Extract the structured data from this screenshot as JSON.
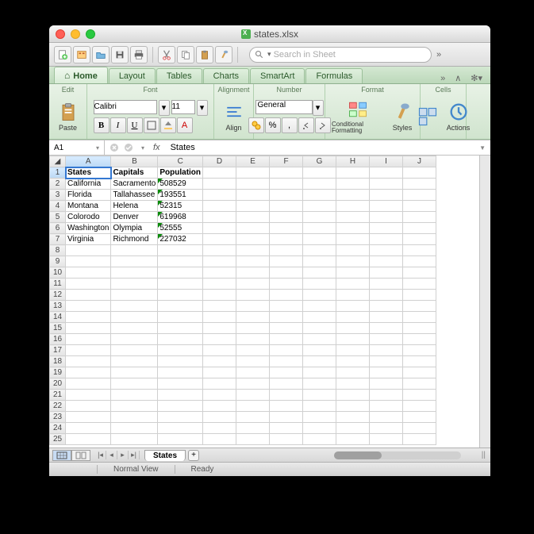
{
  "window": {
    "title": "states.xlsx"
  },
  "search": {
    "placeholder": "Search in Sheet"
  },
  "ribbontabs": [
    "Home",
    "Layout",
    "Tables",
    "Charts",
    "SmartArt",
    "Formulas"
  ],
  "ribbon": {
    "edit": {
      "label": "Edit",
      "paste": "Paste"
    },
    "font": {
      "label": "Font",
      "name": "Calibri",
      "size": "11"
    },
    "alignment": {
      "label": "Alignment",
      "align": "Align"
    },
    "number": {
      "label": "Number",
      "format": "General"
    },
    "format": {
      "label": "Format",
      "cond": "Conditional Formatting",
      "styles": "Styles"
    },
    "cells": {
      "label": "Cells",
      "actions": "Actions"
    }
  },
  "namebox": "A1",
  "formulaValue": "States",
  "columns": [
    "A",
    "B",
    "C",
    "D",
    "E",
    "F",
    "G",
    "H",
    "I",
    "J"
  ],
  "rows": [
    1,
    2,
    3,
    4,
    5,
    6,
    7,
    8,
    9,
    10,
    11,
    12,
    13,
    14,
    15,
    16,
    17,
    18,
    19,
    20,
    21,
    22,
    23,
    24,
    25
  ],
  "cells": {
    "1": {
      "A": "States",
      "B": "Capitals",
      "C": "Population"
    },
    "2": {
      "A": "California",
      "B": "Sacramento",
      "C": "508529"
    },
    "3": {
      "A": "Florida",
      "B": "Tallahassee",
      "C": "193551"
    },
    "4": {
      "A": "Montana",
      "B": "Helena",
      "C": "52315"
    },
    "5": {
      "A": "Colorodo",
      "B": "Denver",
      "C": "619968"
    },
    "6": {
      "A": "Washington",
      "B": "Olympia",
      "C": "52555"
    },
    "7": {
      "A": "Virginia",
      "B": "Richmond",
      "C": "227032"
    }
  },
  "boldCells": [
    "1A",
    "1B",
    "1C"
  ],
  "flagCells": [
    "2C",
    "3C",
    "4C",
    "5C",
    "6C",
    "7C"
  ],
  "selectedCell": "1A",
  "sheetTab": "States",
  "status": {
    "view": "Normal View",
    "ready": "Ready"
  }
}
